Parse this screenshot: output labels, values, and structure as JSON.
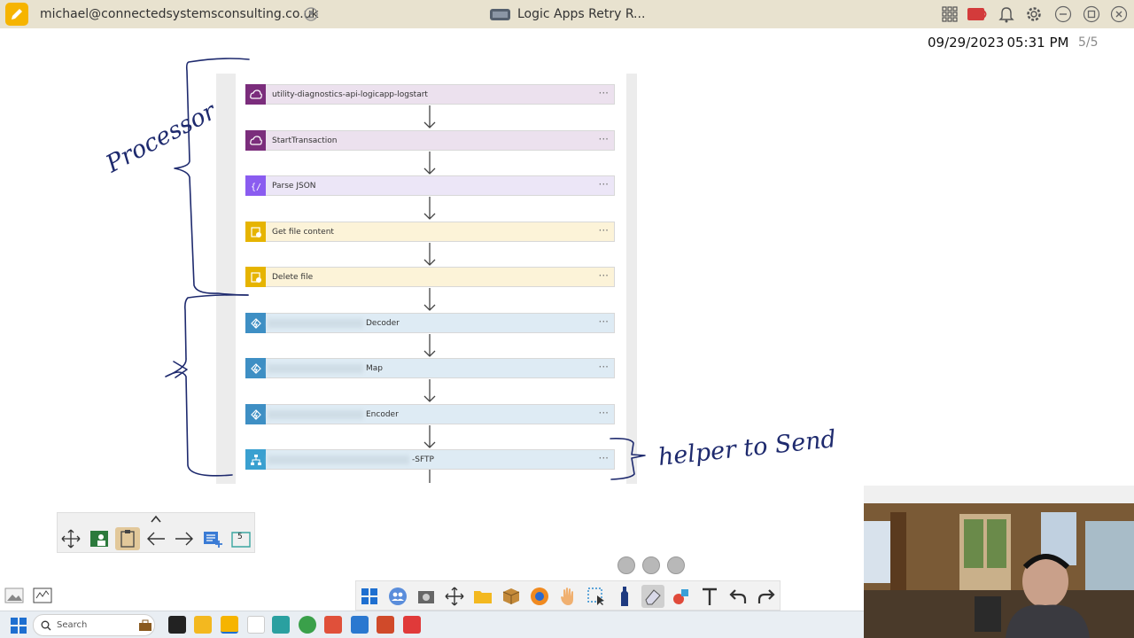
{
  "titlebar": {
    "account": "michael@connectedsystemsconsulting.co.uk",
    "document_title": "Logic Apps Retry R..."
  },
  "header": {
    "date": "09/29/2023",
    "time": "05:31 PM",
    "page_count": "5/5"
  },
  "workflow": {
    "steps": [
      {
        "label": "utility-diagnostics-api-logicapp-logstart",
        "kind": "api",
        "color": "#ece1ee"
      },
      {
        "label": "StartTransaction",
        "kind": "api",
        "color": "#ece1ee"
      },
      {
        "label": "Parse JSON",
        "kind": "json",
        "color": "#ece6f7"
      },
      {
        "label": "Get file content",
        "kind": "file",
        "color": "#fcf3d8"
      },
      {
        "label": "Delete file",
        "kind": "file",
        "color": "#fcf3d8"
      },
      {
        "label": "Decoder",
        "kind": "function",
        "color": "#deebf4"
      },
      {
        "label": "Map",
        "kind": "function",
        "color": "#deebf4"
      },
      {
        "label": "Encoder",
        "kind": "function",
        "color": "#deebf4"
      },
      {
        "label": "-SFTP",
        "kind": "workflow",
        "color": "#deebf4"
      }
    ],
    "more_options": "···"
  },
  "annotations": {
    "processor": "Processor",
    "helper": "helper to Send"
  },
  "mini_toolbar": {
    "page_number": "5"
  },
  "taskbar": {
    "search_label": "Search"
  },
  "colors": {
    "titlebar": "#e8e2cf",
    "ink": "#1e2a6e",
    "api_icon": "#7b2d7c",
    "json_icon": "#8a5cf0",
    "file_icon": "#e6b400",
    "function_icon": "#3e8fc4"
  }
}
